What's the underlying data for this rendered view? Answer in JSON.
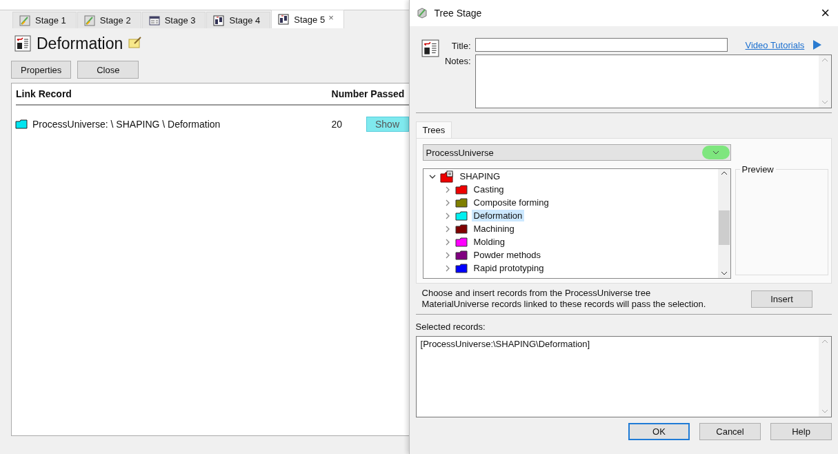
{
  "stage_window": {
    "tabs": [
      {
        "label": "Stage 1",
        "kind": "chart",
        "selected": false
      },
      {
        "label": "Stage 2",
        "kind": "chart",
        "selected": false
      },
      {
        "label": "Stage 3",
        "kind": "table",
        "selected": false
      },
      {
        "label": "Stage 4",
        "kind": "tree",
        "selected": false
      },
      {
        "label": "Stage 5",
        "kind": "tree",
        "selected": true,
        "close": "×"
      }
    ],
    "heading": "Deformation",
    "buttons": [
      "Properties",
      "Close"
    ],
    "table": {
      "columns": [
        "Link Record",
        "Number Passed"
      ],
      "rows": [
        {
          "record": "ProcessUniverse: \\ SHAPING \\ Deformation",
          "color": "#00e5f0",
          "count": "20",
          "action": {
            "label": "Show",
            "highlighted": true
          }
        }
      ]
    }
  },
  "dialog": {
    "title": "Tree Stage",
    "close": "×",
    "title_label": "Title:",
    "link": "Video Tutorials",
    "notes_label": "Notes:",
    "tabs": [
      {
        "label": "Trees",
        "selected": true
      }
    ],
    "dropdown": {
      "value": "ProcessUniverse",
      "highlighted": true
    },
    "tree": [
      {
        "label": "SHAPING",
        "expanded": true,
        "selected": false,
        "children": [
          {
            "label": "Casting",
            "color": "#ee0000",
            "expanded": false,
            "selected": false
          },
          {
            "label": "Composite forming",
            "color": "#808000",
            "expanded": false,
            "selected": false
          },
          {
            "label": "Deformation",
            "color": "#00f0f0",
            "expanded": false,
            "selected": true
          },
          {
            "label": "Machining",
            "color": "#800000",
            "expanded": false,
            "selected": false
          },
          {
            "label": "Molding",
            "color": "#ff00ff",
            "expanded": false,
            "selected": false
          },
          {
            "label": "Powder methods",
            "color": "#800080",
            "expanded": false,
            "selected": false
          },
          {
            "label": "Rapid prototyping",
            "color": "#0000ff",
            "expanded": false,
            "selected": false
          }
        ]
      }
    ],
    "preview_label": "Preview",
    "hint": [
      "Choose and insert records from the ProcessUniverse tree",
      "MaterialUniverse records linked to these records will pass the selection."
    ],
    "insert": "Insert",
    "selected_label": "Selected records:",
    "selected_value": "[ProcessUniverse:\\SHAPING\\Deformation]",
    "buttons": [
      {
        "label": "OK",
        "default": true
      },
      {
        "label": "Cancel",
        "default": false
      },
      {
        "label": "Help",
        "default": false
      }
    ]
  }
}
